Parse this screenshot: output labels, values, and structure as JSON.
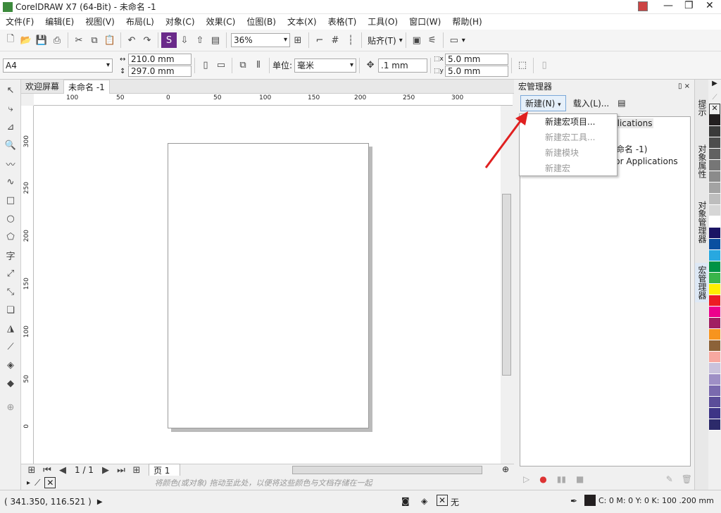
{
  "app": {
    "title": "CorelDRAW X7 (64-Bit) - 未命名 -1"
  },
  "menu": [
    "文件(F)",
    "编辑(E)",
    "视图(V)",
    "布局(L)",
    "对象(C)",
    "效果(C)",
    "位图(B)",
    "文本(X)",
    "表格(T)",
    "工具(O)",
    "窗口(W)",
    "帮助(H)"
  ],
  "toolbar": {
    "zoom": "36%",
    "snap": "贴齐(T)"
  },
  "property_bar": {
    "page_size": "A4",
    "width": "210.0 mm",
    "height": "297.0 mm",
    "units_label": "单位:",
    "units": "毫米",
    "nudge": ".1 mm",
    "dup_x": "5.0 mm",
    "dup_y": "5.0 mm"
  },
  "doc_tabs": [
    "欢迎屏幕",
    "未命名 -1"
  ],
  "ruler_h_labels": [
    "100",
    "50",
    "0",
    "50",
    "100",
    "150",
    "200",
    "250",
    "300"
  ],
  "ruler_v_labels": [
    "300",
    "250",
    "200",
    "150",
    "100",
    "50",
    "0"
  ],
  "page_nav": {
    "counter": "1 / 1",
    "page_tab": "页 1"
  },
  "color_hint": "将颜色(或对象) 拖动至此处，以便将这些颜色与文档存储在一起",
  "status": {
    "coords": "( 341.350, 116.521 )",
    "fill": "无",
    "outline": "C: 0 M: 0 Y: 0 K: 100  .200 mm"
  },
  "docker": {
    "title": "宏管理器",
    "new_button": "新建(N)",
    "load_button": "载入(L)...",
    "tree_fragments": [
      "plications",
      "命名 -1)",
      "s for Applications"
    ],
    "menu_items": [
      {
        "label": "新建宏项目...",
        "enabled": true
      },
      {
        "label": "新建宏工具...",
        "enabled": false
      },
      {
        "label": "新建模块",
        "enabled": false
      },
      {
        "label": "新建宏",
        "enabled": false
      }
    ]
  },
  "side_tabs": [
    "提示",
    "对象属性",
    "对象管理器",
    "宏管理器"
  ],
  "palette": [
    "#231f20",
    "#3a3a3a",
    "#4d4d4d",
    "#616161",
    "#767676",
    "#8b8b8b",
    "#a3a3a3",
    "#bdbdbd",
    "#d6d6d6",
    "#ffffff",
    "#1b1464",
    "#0a4fa0",
    "#28a8e0",
    "#009245",
    "#39b54a",
    "#ffef00",
    "#ed1c24",
    "#ec008c",
    "#a01f62",
    "#f7941e",
    "#8c6239",
    "#f7a8a0",
    "#c9c2dc",
    "#9e8fc5",
    "#7a6aae",
    "#5b4d99",
    "#3d3486",
    "#2c2a6a"
  ]
}
